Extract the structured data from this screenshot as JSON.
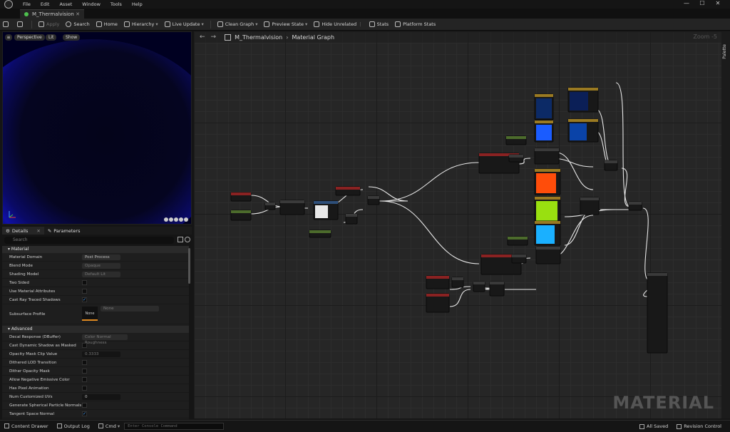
{
  "app": {
    "menu": [
      "File",
      "Edit",
      "Asset",
      "Window",
      "Tools",
      "Help"
    ],
    "window_controls": [
      "—",
      "☐",
      "✕"
    ]
  },
  "tab": {
    "title": "M_Thermalvision",
    "close": "✕"
  },
  "toolbar": {
    "apply": "Apply",
    "search": "Search",
    "home": "Home",
    "hierarchy": "Hierarchy",
    "live_update": "Live Update",
    "clean_graph": "Clean Graph",
    "preview_state": "Preview State",
    "hide_unrelated": "Hide Unrelated",
    "stats": "Stats",
    "platform_stats": "Platform Stats"
  },
  "viewport": {
    "perspective": "Perspective",
    "lit": "Lit",
    "show": "Show"
  },
  "details": {
    "tabs": [
      "Details",
      "Parameters"
    ],
    "search_placeholder": "Search",
    "sections": {
      "material": "Material",
      "advanced": "Advanced"
    },
    "material_rows": [
      {
        "label": "Material Domain",
        "value": "Post Process",
        "type": "select"
      },
      {
        "label": "Blend Mode",
        "value": "Opaque",
        "type": "select",
        "dim": true
      },
      {
        "label": "Shading Model",
        "value": "Default Lit",
        "type": "select",
        "dim": true
      },
      {
        "label": "Two Sided",
        "type": "check",
        "checked": false
      },
      {
        "label": "Use Material Attributes",
        "type": "check",
        "checked": false
      },
      {
        "label": "Cast Ray Traced Shadows",
        "type": "check",
        "checked": true
      },
      {
        "label": "Subsurface Profile",
        "value": "None",
        "type": "asset"
      }
    ],
    "advanced_rows": [
      {
        "label": "Decal Response (DBuffer)",
        "value": "Color Normal Roughness",
        "type": "select",
        "dim": true
      },
      {
        "label": "Cast Dynamic Shadow as Masked",
        "type": "check",
        "checked": false
      },
      {
        "label": "Opacity Mask Clip Value",
        "value": "0.3333",
        "type": "number",
        "dim": true
      },
      {
        "label": "Dithered LOD Transition",
        "type": "check",
        "checked": false
      },
      {
        "label": "Dither Opacity Mask",
        "type": "check",
        "checked": false
      },
      {
        "label": "Allow Negative Emissive Color",
        "type": "check",
        "checked": false
      },
      {
        "label": "Has Pixel Animation",
        "type": "check",
        "checked": false
      },
      {
        "label": "Num Customized UVs",
        "value": "0",
        "type": "number"
      },
      {
        "label": "Generate Spherical Particle Normals",
        "type": "check",
        "checked": false
      },
      {
        "label": "Tangent Space Normal",
        "type": "check",
        "checked": true
      }
    ]
  },
  "graph": {
    "breadcrumb_root": "M_Thermalvision",
    "breadcrumb_leaf": "Material Graph",
    "zoom": "Zoom -5",
    "watermark": "MATERIAL",
    "palette": "Palette",
    "node_colors": {
      "red": "#8a2222",
      "green": "#4c6b2c",
      "blue": "#2e4f7a",
      "gray": "#3a3a3a",
      "gold": "#9a7a22"
    },
    "swatches": [
      "#0c2a66",
      "#0b1f57",
      "#1a5cff",
      "#0a43a8",
      "#ff4d0a",
      "#99e010",
      "#1ab0ff",
      "#e8e8e8"
    ]
  },
  "statusbar": {
    "content_drawer": "Content Drawer",
    "output_log": "Output Log",
    "cmd": "Cmd",
    "console_placeholder": "Enter Console Command",
    "all_saved": "All Saved",
    "revision_control": "Revision Control"
  }
}
